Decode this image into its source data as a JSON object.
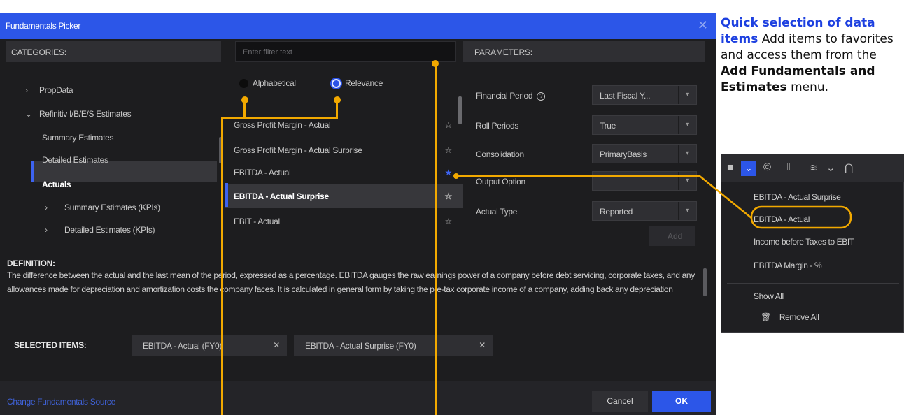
{
  "dialog": {
    "title": "Fundamentals Picker",
    "close_icon": "close-icon"
  },
  "categories": {
    "header": "CATEGORIES:",
    "items": [
      {
        "label": "PropData",
        "arrow": ">"
      },
      {
        "label": "Refinitiv I/B/E/S Estimates",
        "arrow": "v"
      },
      {
        "label": "Summary Estimates"
      },
      {
        "label": "Detailed Estimates"
      },
      {
        "label": "Actuals",
        "selected": true
      },
      {
        "label": "Summary Estimates (KPIs)",
        "arrow": ">"
      },
      {
        "label": "Detailed Estimates (KPIs)",
        "arrow": ">"
      }
    ]
  },
  "filter": {
    "placeholder": "Enter filter text"
  },
  "sort": {
    "alphabetical": "Alphabetical",
    "relevance": "Relevance",
    "selected": "Relevance"
  },
  "list": {
    "items": [
      {
        "label": "Gross Profit Margin - Actual",
        "favorite": false
      },
      {
        "label": "Gross Profit Margin - Actual Surprise",
        "favorite": false
      },
      {
        "label": "EBITDA - Actual",
        "favorite": true
      },
      {
        "label": "EBITDA - Actual Surprise",
        "favorite": false,
        "selected": true
      },
      {
        "label": "EBIT - Actual",
        "favorite": false
      }
    ]
  },
  "parameters": {
    "header": "PARAMETERS:",
    "financial_period": {
      "label": "Financial Period",
      "value": "Last Fiscal Y..."
    },
    "roll_periods": {
      "label": "Roll Periods",
      "value": "True"
    },
    "consolidation": {
      "label": "Consolidation",
      "value": "PrimaryBasis"
    },
    "output_option": {
      "label": "Output Option",
      "value": ""
    },
    "actual_type": {
      "label": "Actual Type",
      "value": "Reported"
    },
    "add_label": "Add"
  },
  "definition": {
    "title": "DEFINITION:",
    "text": "The difference between the actual and the last mean of the period, expressed as a percentage. EBITDA gauges the raw earnings power of a company before debt servicing, corporate taxes, and any allowances made for depreciation and amortization costs the company faces. It is calculated in general form by taking the pre-tax corporate income of a company, adding back any depreciation"
  },
  "selected_items": {
    "label": "SELECTED ITEMS:",
    "chips": [
      "EBITDA - Actual (FY0)",
      "EBITDA - Actual Surprise (FY0)"
    ]
  },
  "footer": {
    "source_link": "Change Fundamentals Source",
    "cancel": "Cancel",
    "ok": "OK"
  },
  "callout": {
    "heading": "Quick selection of data items",
    "text_1": "Add items to favorites and access them from the",
    "menu_name": "Add Fundamentals and Estimates",
    "text_2": "menu."
  },
  "menu": {
    "items": [
      "EBITDA - Actual Surprise",
      "EBITDA - Actual",
      "Income before Taxes to EBIT",
      "EBITDA Margin - %"
    ],
    "show_all": "Show All",
    "remove_all": "Remove All"
  },
  "colors": {
    "accent": "#2c56e8",
    "annotation": "#f2a900",
    "dialog_bg": "#1d1d1f"
  }
}
